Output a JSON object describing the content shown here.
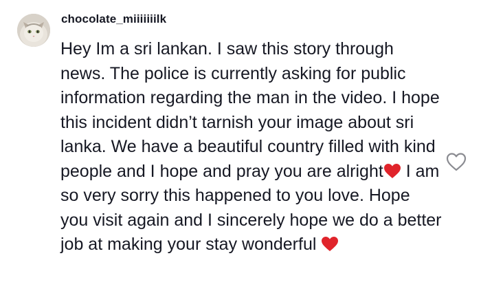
{
  "comment": {
    "username": "chocolate_miiiiiiilk",
    "text_part1": "Hey Im a sri lankan. I saw this story through news. The police is currently asking for public information regarding the man in the video. I hope this incident didn’t tarnish your image about sri lanka. We have a beautiful country filled with kind people and I hope and pray you are alright",
    "text_part2": " I am so very sorry this happened to you love. Hope you visit again and I sincerely hope we do a better job at making your stay wonderful ",
    "emoji": "red-heart-icon",
    "like_icon": "heart-outline-icon"
  },
  "colors": {
    "text": "#161823",
    "heart": "#e0242b",
    "like_outline": "#8a8b91"
  }
}
